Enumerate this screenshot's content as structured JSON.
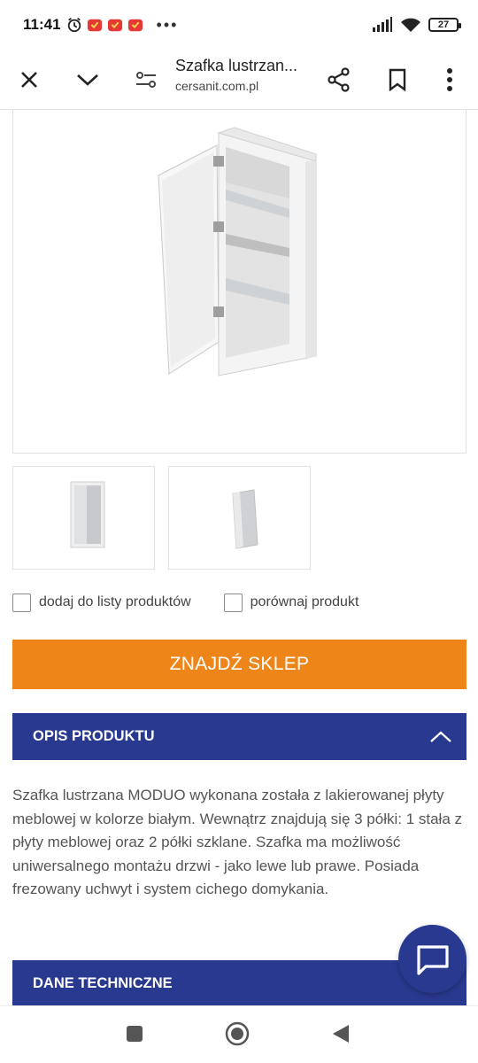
{
  "status_bar": {
    "time": "11:41",
    "overflow": "•••",
    "battery": "27",
    "icons": [
      "alarm-icon",
      "app-notification-icon",
      "app-notification-icon",
      "app-notification-icon",
      "signal-icon",
      "wifi-icon",
      "battery-icon"
    ]
  },
  "browser": {
    "page_title": "Szafka lustrzan...",
    "domain": "cersanit.com.pl",
    "icons": [
      "close-icon",
      "chevron-down-icon",
      "page-settings-icon",
      "share-icon",
      "bookmark-icon",
      "more-vert-icon"
    ]
  },
  "product": {
    "add_to_list_label": "dodaj do listy produktów",
    "compare_label": "porównaj produkt",
    "find_store_label": "ZNAJDŹ SKLEP",
    "description_header": "OPIS PRODUKTU",
    "description_text": "Szafka lustrzana MODUO wykonana została z lakierowanej płyty meblowej w kolorze białym. Wewnątrz znajdują się 3 półki: 1 stała z płyty meblowej oraz 2 półki szklane. Szafka ma możliwość uniwersalnego montażu drzwi - jako lewe lub prawe. Posiada frezowany uchwyt i system cichego domykania.",
    "technical_header": "DANE TECHNICZNE"
  },
  "colors": {
    "accent_orange": "#ed8518",
    "navy": "#2a3990"
  }
}
